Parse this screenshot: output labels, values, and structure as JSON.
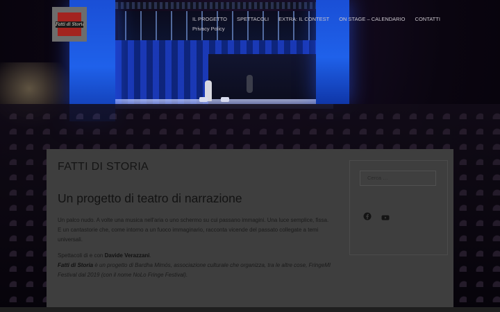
{
  "site": {
    "logo_text": "Fatti di Storia",
    "nav": {
      "row1": [
        "IL PROGETTO",
        "SPETTACOLI",
        "EXTRA: IL CONTEST",
        "ON STAGE – CALENDARIO",
        "CONTATTI"
      ],
      "row2": [
        "Privacy Policy"
      ]
    }
  },
  "main": {
    "title": "FATTI DI STORIA",
    "subtitle": "Un progetto di teatro di narrazione",
    "paragraph1": "Un palco nudo. A volte una musica nell'aria o uno schermo su cui passano immagini. Una luce semplice, fissa. E un cantastorie che, come intorno a un fuoco immaginario, racconta vicende del passato collegate a temi universali.",
    "credits_prefix": "Spettacoli di e con ",
    "credits_name": "Davide Verazzani",
    "credits_suffix": ".",
    "project_name": "Fatti di Storia",
    "project_desc": " è un progetto di Bardha Mimós, associazione culturale che organizza, tra le altre cose, FringeMI Festival dal 2019 (con il nome NoLo Fringe Festival)."
  },
  "sidebar": {
    "search_placeholder": "Cerca …",
    "social": [
      "facebook-icon",
      "youtube-icon"
    ]
  },
  "colors": {
    "panel": "#3e3e3e",
    "stage_blue": "#1f61ea",
    "logo_red": "#a3231f"
  }
}
